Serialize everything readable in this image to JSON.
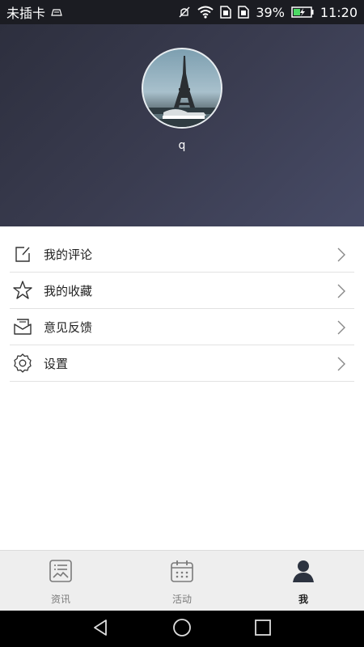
{
  "status_bar": {
    "carrier": "未插卡",
    "battery_percent": "39%",
    "time": "11:20",
    "icons": [
      "sim-card-icon",
      "mute-icon",
      "wifi-icon",
      "sim1-icon",
      "sim2-icon",
      "battery-charging-icon"
    ]
  },
  "profile": {
    "username": "q",
    "avatar_icon": "eiffel-tower-avatar"
  },
  "menu": {
    "items": [
      {
        "label": "我的评论",
        "icon": "edit-icon"
      },
      {
        "label": "我的收藏",
        "icon": "star-icon"
      },
      {
        "label": "意见反馈",
        "icon": "mail-icon"
      },
      {
        "label": "设置",
        "icon": "gear-icon"
      }
    ]
  },
  "bottom_nav": {
    "tabs": [
      {
        "label": "资讯",
        "icon": "news-icon",
        "active": false
      },
      {
        "label": "活动",
        "icon": "calendar-icon",
        "active": false
      },
      {
        "label": "我",
        "icon": "user-icon",
        "active": true
      }
    ]
  },
  "system_nav": {
    "buttons": [
      "back-icon",
      "home-icon",
      "recents-icon"
    ]
  },
  "colors": {
    "header_start": "#2d2f3e",
    "header_end": "#474b66",
    "status_bar": "#1b1c22",
    "active_tab": "#222222",
    "inactive_tab": "#7a7a7a"
  }
}
